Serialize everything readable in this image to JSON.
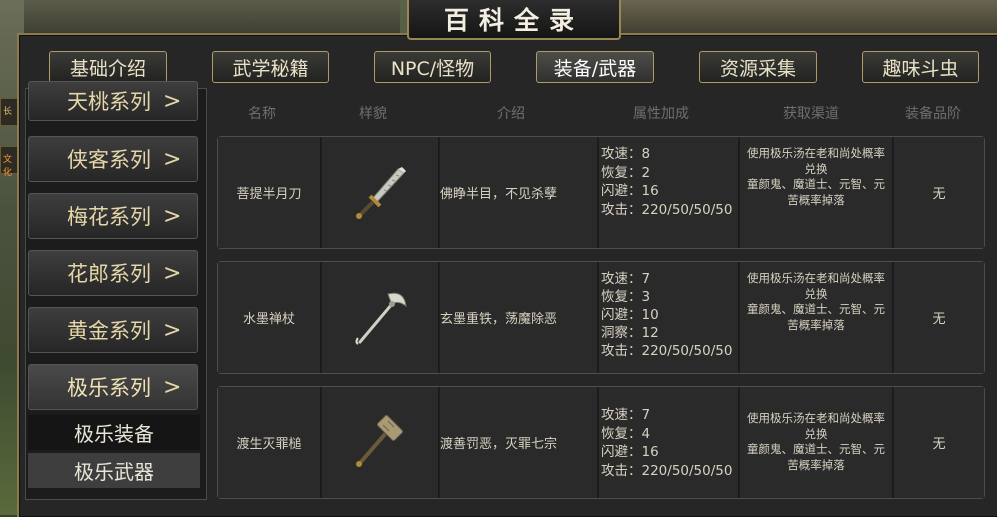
{
  "window": {
    "title": "百科全录"
  },
  "left_edge": {
    "item1": "长",
    "item2": "文化"
  },
  "tabs": [
    {
      "label": "基础介绍"
    },
    {
      "label": "武学秘籍"
    },
    {
      "label": "NPC/怪物"
    },
    {
      "label": "装备/武器",
      "active": true
    },
    {
      "label": "资源采集"
    },
    {
      "label": "趣味斗虫"
    }
  ],
  "sidebar": {
    "items": [
      {
        "label": "天桃系列"
      },
      {
        "label": "侠客系列"
      },
      {
        "label": "梅花系列"
      },
      {
        "label": "花郎系列"
      },
      {
        "label": "黄金系列"
      },
      {
        "label": "极乐系列",
        "expanded": true
      }
    ],
    "chevron": ">",
    "subitems": [
      {
        "label": "极乐装备"
      },
      {
        "label": "极乐武器",
        "selected": true
      }
    ]
  },
  "table": {
    "headers": [
      "名称",
      "样貌",
      "介绍",
      "属性加成",
      "获取渠道",
      "装备品阶"
    ],
    "rows": [
      {
        "name": "菩提半月刀",
        "icon": "broadsword-icon",
        "desc": "佛睁半目，不见杀孽",
        "attrs": [
          "攻速：8",
          "恢复：2",
          "闪避：16",
          "攻击：220/50/50/50"
        ],
        "source": [
          "使用极乐汤在老和尚处概率兑换",
          "童颜鬼、魔道士、元智、元苦概率掉落"
        ],
        "grade": "无"
      },
      {
        "name": "水墨禅杖",
        "icon": "monk-staff-icon",
        "desc": "玄墨重铁，荡魔除恶",
        "attrs": [
          "攻速：7",
          "恢复：3",
          "闪避：10",
          "洞察：12",
          "攻击：220/50/50/50"
        ],
        "source": [
          "使用极乐汤在老和尚处概率兑换",
          "童颜鬼、魔道士、元智、元苦概率掉落"
        ],
        "grade": "无"
      },
      {
        "name": "渡生灭罪槌",
        "icon": "war-hammer-icon",
        "desc": "渡善罚恶，灭罪七宗",
        "attrs": [
          "攻速：7",
          "恢复：4",
          "闪避：16",
          "攻击：220/50/50/50"
        ],
        "source": [
          "使用极乐汤在老和尚处概率兑换",
          "童颜鬼、魔道士、元智、元苦概率掉落"
        ],
        "grade": "无"
      }
    ]
  }
}
